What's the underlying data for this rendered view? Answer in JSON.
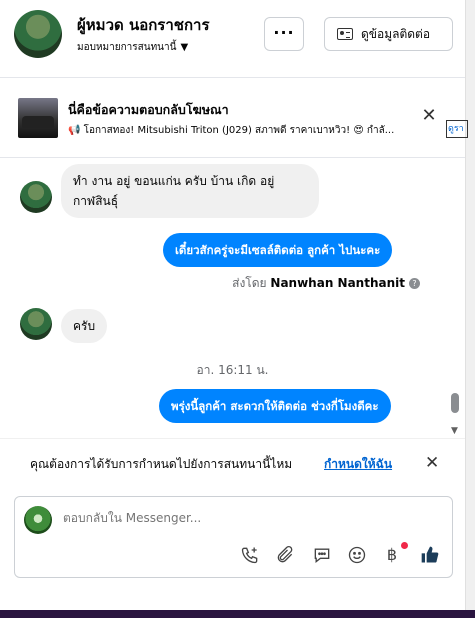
{
  "header": {
    "name": "ผู้หมวด นอกราชการ",
    "assignment": "มอบหมายการสนทนานี้",
    "more_label": "···",
    "contact_button": "ดูข้อมูลติดต่อ"
  },
  "ad": {
    "title": "นี่คือข้อความตอบกลับโฆษณา",
    "text": "📢 โอกาสทอง! Mitsubishi Triton (J029) สภาพดี ราคาเบาหวิว! 😍 กำลั...",
    "edge_text": "ดูรา"
  },
  "messages": {
    "m1": "ทำ งาน อยู่ ขอนแก่น ครับ บ้าน เกิด อยู่ กาฬสินธุ์",
    "m2": "เดี๋ยวสักครู่จะมีเซลล์ติดต่อ ลูกค้า ไปนะคะ",
    "sent_by_prefix": "ส่งโดย",
    "sent_by_name": "Nanwhan Nanthanit",
    "m3": "ครับ",
    "timestamp": "อา. 16:11 น.",
    "m4": "พรุ่งนี้ลูกค้า สะดวกให้ติดต่อ ช่วงกี่โมงดีคะ"
  },
  "notice": {
    "text": "คุณต้องการได้รับการกำหนดไปยังการสนทนานี้ไหม",
    "link": "กำหนดให้ฉัน"
  },
  "composer": {
    "placeholder": "ตอบกลับใน Messenger...",
    "currency": "฿"
  }
}
